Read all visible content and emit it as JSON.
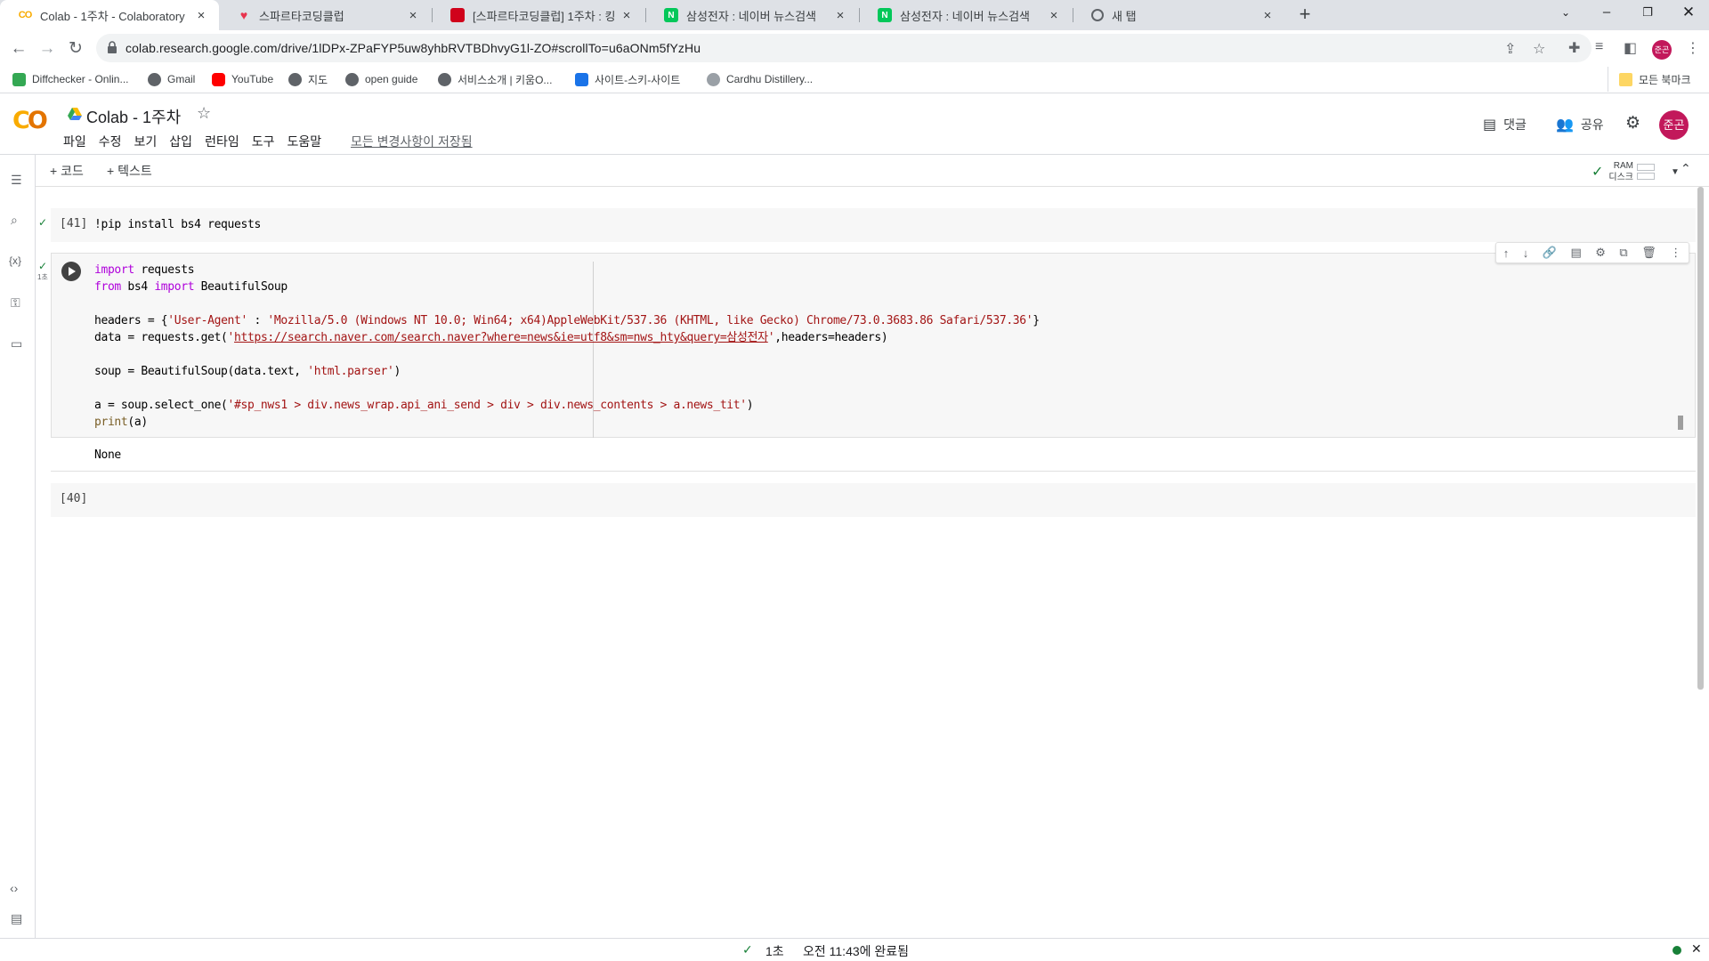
{
  "browser": {
    "tabs": [
      {
        "title": "Colab - 1주차 - Colaboratory",
        "icon": "colab-favicon-icon",
        "active": true
      },
      {
        "title": "스파르타코딩클럽",
        "icon": "sparta-heart-icon",
        "active": false
      },
      {
        "title": "[스파르타코딩클럽] 1주차 : 킹",
        "icon": "sparta-book-icon",
        "active": false
      },
      {
        "title": "삼성전자 : 네이버 뉴스검색",
        "icon": "naver-n-icon",
        "active": false
      },
      {
        "title": "삼성전자 : 네이버 뉴스검색",
        "icon": "naver-n-icon",
        "active": false
      },
      {
        "title": "새 탭",
        "icon": "globe-icon",
        "active": false
      }
    ],
    "url": "colab.research.google.com/drive/1lDPx-ZPaFYP5uw8yhbRVTBDhvyG1l-ZO#scrollTo=u6aONm5fYzHu",
    "profile_initials": "준곤",
    "bookmarks": [
      {
        "label": "Diffchecker - Onlin...",
        "color": "#34a853"
      },
      {
        "label": "Gmail",
        "color": "#5f6368"
      },
      {
        "label": "YouTube",
        "color": "#ff0000"
      },
      {
        "label": "지도",
        "color": "#5f6368"
      },
      {
        "label": "open guide",
        "color": "#5f6368"
      },
      {
        "label": "서비스소개 | 키움O...",
        "color": "#5f6368"
      },
      {
        "label": "사이트-스키-사이트",
        "color": "#1a73e8"
      },
      {
        "label": "Cardhu Distillery...",
        "color": "#9aa0a6"
      }
    ],
    "all_bookmarks": "모든 북마크"
  },
  "colab": {
    "notebook_title": "Colab - 1주차",
    "menu": [
      "파일",
      "수정",
      "보기",
      "삽입",
      "런타임",
      "도구",
      "도움말"
    ],
    "saved_status": "모든 변경사항이 저장됨",
    "comment_label": "댓글",
    "share_label": "공유",
    "user_initials": "준곤",
    "add_code": "+ 코드",
    "add_text": "+ 텍스트",
    "ram_label": "RAM",
    "disk_label": "디스크",
    "brand_color": "#f9ab00"
  },
  "cells": [
    {
      "exec": "[41]",
      "code": "!pip install bs4 requests"
    },
    {
      "exec": "",
      "run_time": "1초",
      "output": "None"
    },
    {
      "exec": "[40]"
    }
  ],
  "status": {
    "time": "1초",
    "completed": "오전 11:43에 완료됨"
  }
}
